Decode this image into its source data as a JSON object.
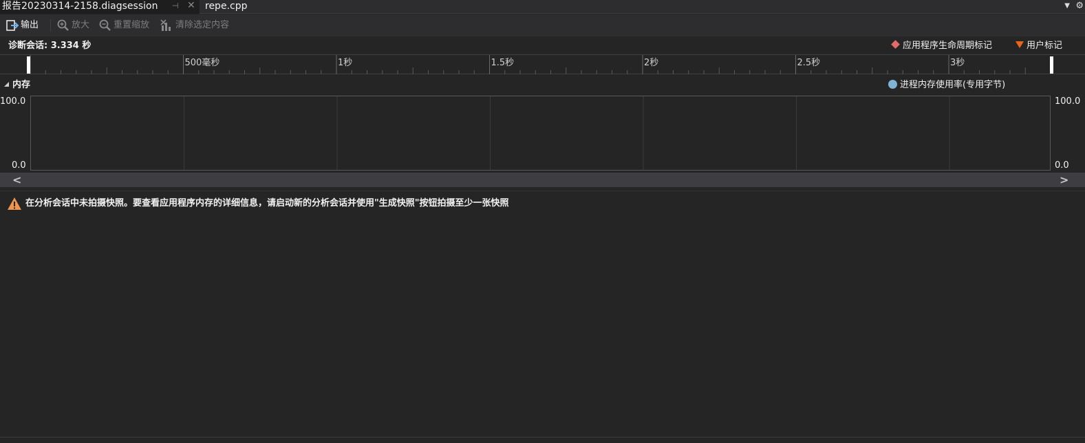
{
  "tabs": [
    {
      "label": "报告20230314-2158.diagsession",
      "active": true,
      "pinned": true,
      "pin_icon": "pin-icon",
      "close_icon": "close-icon"
    },
    {
      "label": "repe.cpp",
      "active": false
    }
  ],
  "tab_controls": {
    "menu_icon": "dropdown-icon",
    "gear_icon": "gear-icon"
  },
  "toolbar": {
    "output_label": "输出",
    "zoom_in_label": "放大",
    "reset_zoom_label": "重置缩放",
    "clear_selection_label": "清除选定内容"
  },
  "session": {
    "label": "诊断会话: 3.334 秒"
  },
  "top_legend": {
    "lifecycle_label": "应用程序生命周期标记",
    "lifecycle_color": "#e06c6c",
    "user_label": "用户标记",
    "user_color": "#e8651c"
  },
  "ruler": {
    "tick_labels": [
      "500毫秒",
      "1秒",
      "1.5秒",
      "2秒",
      "2.5秒",
      "3秒"
    ]
  },
  "memory": {
    "title": "内存",
    "legend_label": "进程内存使用率(专用字节)",
    "legend_color": "#7fb2d3",
    "y_max_left": "100.0",
    "y_min_left": "0.0",
    "y_max_right": "100.0",
    "y_min_right": "0.0"
  },
  "message": {
    "text": "在分析会话中未拍摄快照。要查看应用程序内存的详细信息，请启动新的分析会话并使用\"生成快照\"按钮拍摄至少一张快照",
    "icon": "warning-icon",
    "icon_color": "#f0954d"
  }
}
